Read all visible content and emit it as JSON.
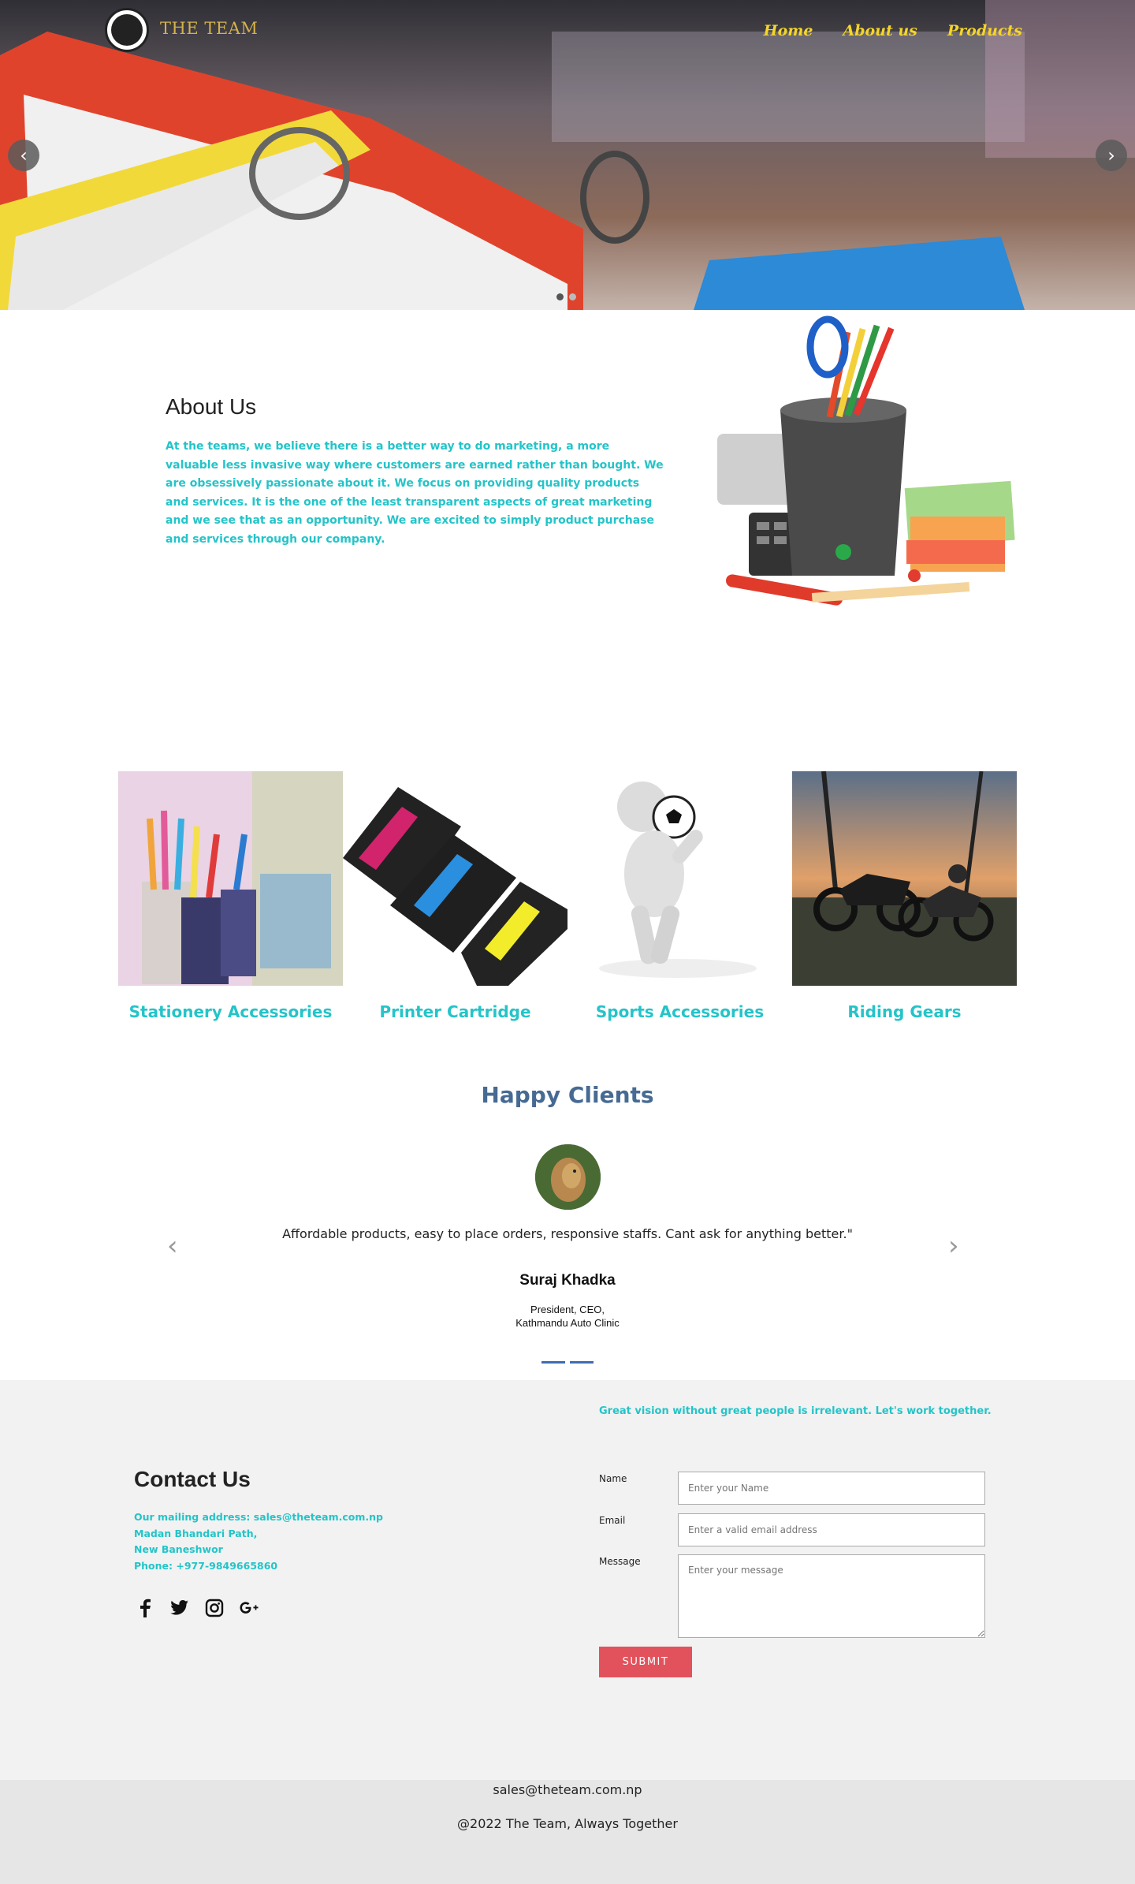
{
  "header": {
    "brand": "THE TEAM",
    "nav": [
      "Home",
      "About us",
      "Products"
    ]
  },
  "hero": {
    "prev_icon": "chevron-left-icon",
    "next_icon": "chevron-right-icon",
    "arrow_left": "‹",
    "arrow_right": "›"
  },
  "about": {
    "title": "About Us",
    "text": "At the teams, we believe there is a better way to do marketing, a more valuable less invasive way where customers are earned rather than bought. We are obsessively passionate about it.  We focus on providing quality products and services. It is the one of the least transparent aspects of great marketing  and we see that as an opportunity. We are excited to simply product purchase and services through our company."
  },
  "products": [
    {
      "label": "Stationery Accessories"
    },
    {
      "label": "Printer Cartridge"
    },
    {
      "label": "Sports Accessories"
    },
    {
      "label": "Riding Gears"
    }
  ],
  "clients": {
    "title": "Happy Clients",
    "quote": "Affordable products, easy to place orders, responsive staffs. Cant ask for anything better.\"",
    "name": "Suraj Khadka",
    "role_line1": "President, CEO,",
    "role_line2": "Kathmandu Auto Clinic",
    "arrow_left": "‹",
    "arrow_right": "›"
  },
  "contact": {
    "tagline": "Great vision without great people is irrelevant. Let's work together.",
    "title": "Contact Us",
    "mailing": "Our mailing address:  sales@theteam.com.np",
    "address1": "Madan Bhandari Path,",
    "address2": "New Baneshwor",
    "phone": "Phone: +977-9849665860",
    "socials": [
      "facebook-icon",
      "twitter-icon",
      "instagram-icon",
      "google-plus-icon"
    ],
    "form": {
      "name_label": "Name",
      "name_placeholder": "Enter your Name",
      "email_label": "Email",
      "email_placeholder": "Enter a valid email address",
      "message_label": "Message",
      "message_placeholder": "Enter your message",
      "submit": "SUBMIT"
    }
  },
  "footer": {
    "email": "sales@theteam.com.np",
    "copyright": "@2022 The Team, Always Together"
  },
  "colors": {
    "accent": "#24c4c8",
    "nav": "#f4d52a",
    "clients_title": "#476a93",
    "submit": "#e2525c",
    "contact_bg": "#f2f2f2",
    "footer_bg": "#e6e6e6"
  }
}
